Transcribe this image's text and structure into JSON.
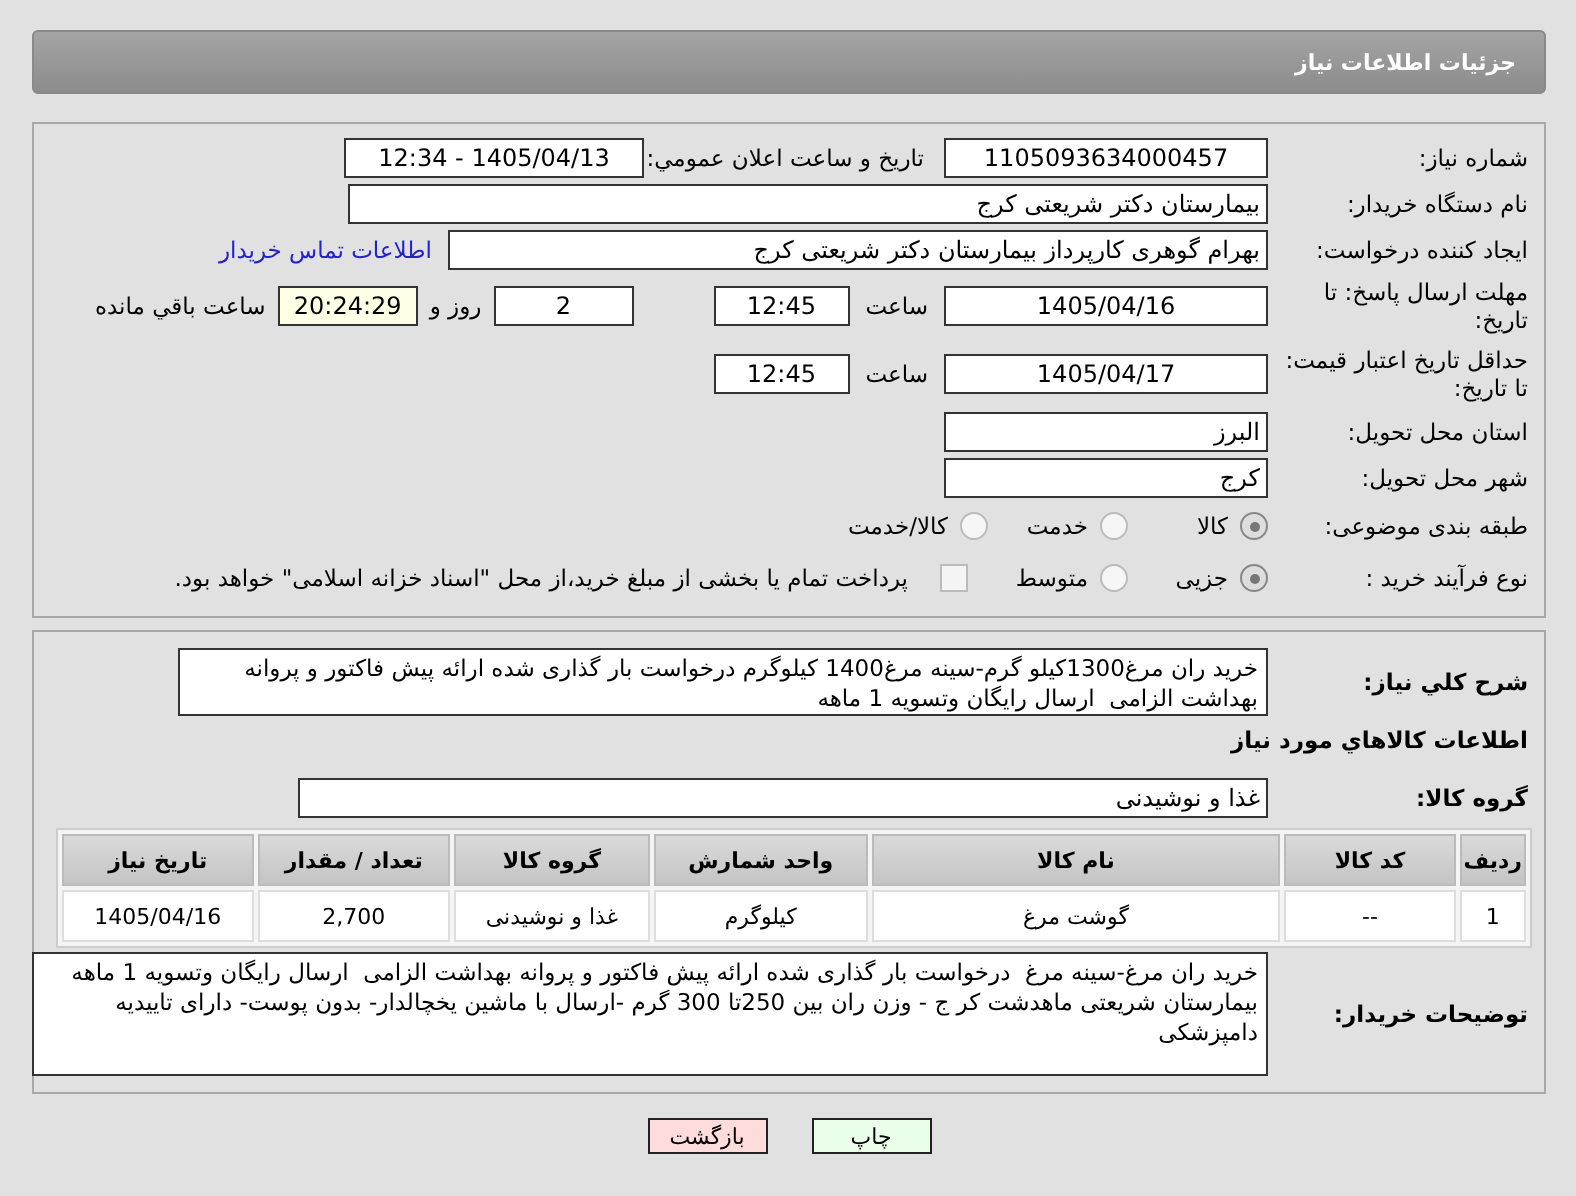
{
  "header": {
    "title": "جزئیات اطلاعات نیاز"
  },
  "form": {
    "need_number": {
      "label": "شماره نیاز:",
      "value": "1105093634000457"
    },
    "announce": {
      "label": "تاریخ و ساعت اعلان عمومي:",
      "value": "1405/04/13 - 12:34"
    },
    "buyer": {
      "label": "نام دستگاه خریدار:",
      "value": "بیمارستان دکتر شریعتی کرج"
    },
    "creator": {
      "label": "ایجاد کننده درخواست:",
      "value": "بهرام گوهری کارپرداز بیمارستان دکتر شریعتی کرج",
      "link": "اطلاعات تماس خریدار"
    },
    "response_deadline": {
      "label": "مهلت ارسال پاسخ: تا تاریخ:",
      "date": "1405/04/16",
      "time_label": "ساعت",
      "time": "12:45",
      "days": "2",
      "days_label": "روز و",
      "remaining": "20:24:29",
      "remaining_label": "ساعت باقي مانده"
    },
    "price_validity": {
      "label": "حداقل تاریخ اعتبار قیمت: تا تاریخ:",
      "date": "1405/04/17",
      "time_label": "ساعت",
      "time": "12:45"
    },
    "province": {
      "label": "استان محل تحویل:",
      "value": "البرز"
    },
    "city": {
      "label": "شهر محل تحویل:",
      "value": "کرج"
    },
    "category": {
      "label": "طبقه بندی موضوعی:",
      "options": [
        {
          "label": "کالا",
          "selected": true
        },
        {
          "label": "خدمت",
          "selected": false
        },
        {
          "label": "کالا/خدمت",
          "selected": false
        }
      ]
    },
    "process": {
      "label": "نوع فرآیند خرید :",
      "options": [
        {
          "label": "جزیی",
          "selected": true
        },
        {
          "label": "متوسط",
          "selected": false
        }
      ],
      "payment": {
        "checked": false,
        "text": "پرداخت تمام یا بخشی از مبلغ خرید،از محل \"اسناد خزانه اسلامی\" خواهد بود."
      }
    }
  },
  "description": {
    "label": "شرح کلي نیاز:",
    "value": "خرید ران مرغ1300کیلو گرم-سینه مرغ1400 کیلوگرم درخواست بار گذاری شده ارائه پیش فاکتور و پروانه بهداشت الزامی  ارسال رایگان وتسویه 1 ماهه"
  },
  "goods": {
    "title": "اطلاعات کالاهاي مورد نیاز",
    "group_label": "گروه کالا:",
    "group": "غذا و نوشیدنی",
    "table": {
      "columns": [
        "ردیف",
        "کد کالا",
        "نام کالا",
        "واحد شمارش",
        "گروه کالا",
        "تعداد / مقدار",
        "تاریخ نیاز"
      ],
      "rows": [
        [
          "1",
          "--",
          "گوشت مرغ",
          "کیلوگرم",
          "غذا و نوشیدنی",
          "2,700",
          "1405/04/16"
        ]
      ]
    }
  },
  "buyer_notes": {
    "label": "توضیحات خریدار:",
    "value": "خرید ران مرغ-سینه مرغ  درخواست بار گذاری شده ارائه پیش فاکتور و پروانه بهداشت الزامی  ارسال رایگان وتسویه 1 ماهه بیمارستان شریعتی ماهدشت کر ج - وزن ران بین 250تا 300 گرم -ارسال با ماشین یخچالدار- بدون پوست- دارای تاییدیه دامپزشکی"
  },
  "buttons": [
    {
      "label": "چاپ",
      "kind": "print"
    },
    {
      "label": "بازگشت",
      "kind": "back"
    }
  ]
}
